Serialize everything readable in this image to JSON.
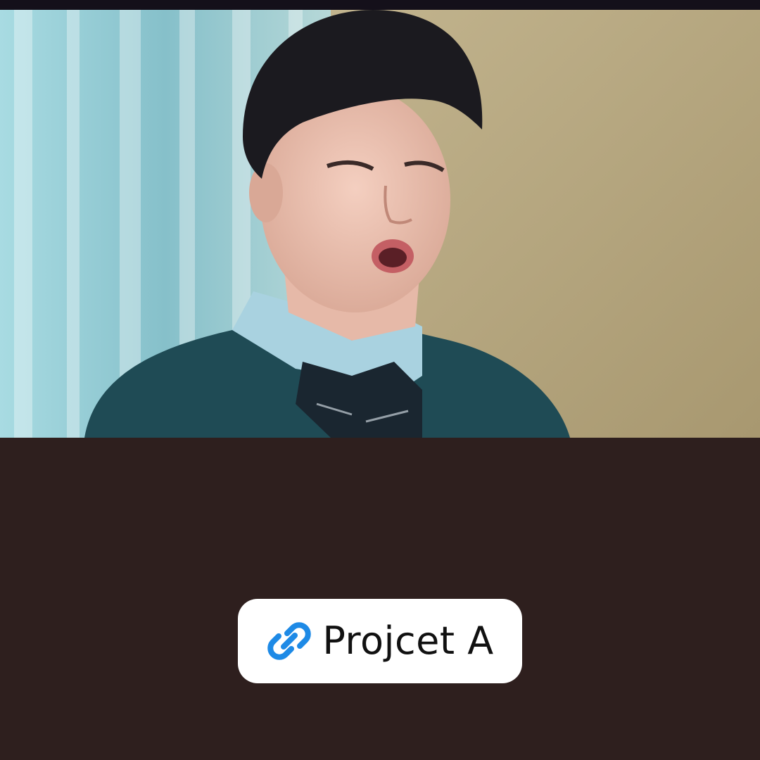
{
  "video": {
    "icon": "video-frame"
  },
  "link_sticker": {
    "label": "Projcet A",
    "icon": "link-icon",
    "icon_color": "#1e8ae6",
    "background": "#ffffff",
    "text_color": "#111111"
  },
  "colors": {
    "page_background": "#2e1f1e",
    "top_strip": "#14101a"
  }
}
